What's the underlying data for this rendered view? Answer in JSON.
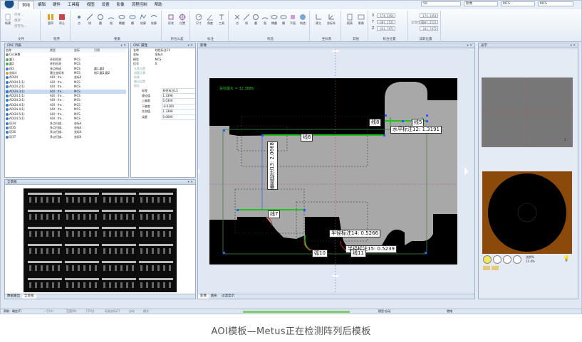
{
  "menu": {
    "items": [
      "常用",
      "编辑",
      "硬件",
      "工具箱",
      "视图",
      "设置",
      "影像",
      "流程控制",
      "帮助"
    ],
    "active": 0
  },
  "ribbon": {
    "groups": [
      {
        "label": "文件",
        "buttons": [
          "新建",
          "打开",
          "保存"
        ],
        "small": [
          "打开...",
          "保存",
          "另存为..."
        ]
      },
      {
        "label": "程序",
        "buttons": [
          "暂停",
          "停止"
        ]
      },
      {
        "label": "要素",
        "buttons": [
          "点",
          "线",
          "圆",
          "弧",
          "椭圆",
          "槽",
          "轮廓",
          "轮廓"
        ]
      },
      {
        "label": "形位公差",
        "buttons": [
          "形状",
          "位置"
        ]
      },
      {
        "label": "标注",
        "buttons": [
          "尺寸",
          "角度",
          "工具"
        ]
      },
      {
        "label": "构造",
        "buttons": [
          "点",
          "线",
          "圆",
          "弧",
          "椭圆",
          "槽",
          "平面",
          "构造"
        ]
      },
      {
        "label": "坐标系",
        "buttons": [
          "建立",
          "坐标系"
        ]
      },
      {
        "label": "其他",
        "buttons": [
          "报表",
          "影像"
        ]
      },
      {
        "label": "机台位置",
        "axes": [
          "X",
          "Y",
          "Z"
        ],
        "values": [
          "-174.3454",
          "-307.2521",
          "-341.7872"
        ],
        "button": "读取位置"
      },
      {
        "label": "读取位置",
        "values": [
          "-174.3454",
          "-307.2521",
          "-341.7872"
        ]
      }
    ],
    "combos": {
      "cam": "50",
      "mode": "影像",
      "coord": "MCS",
      "coord2": "MCS"
    }
  },
  "cnc_list": {
    "title": "CNC 列表",
    "headers": [
      "名称",
      "类型",
      "坐标",
      "引用"
    ],
    "rows": [
      {
        "name": "Cnc参数",
        "type": "",
        "coord": "",
        "ref": ""
      },
      {
        "name": "圆1",
        "type": "环形检测",
        "coord": "MCS",
        "ref": ""
      },
      {
        "name": "圆2",
        "type": "环形检测",
        "coord": "MCS",
        "ref": ""
      },
      {
        "name": "线3",
        "type": "多点构成",
        "coord": "MCS",
        "ref": "圆1,圆2"
      },
      {
        "name": "坐标4",
        "type": "建立坐标系",
        "coord": "MCS",
        "ref": "线3,圆1,圆2"
      },
      {
        "name": "AOI24",
        "type": "AOI : fre...",
        "coord": "坐标4",
        "ref": ""
      },
      {
        "name": "AOI24.1(1)",
        "type": "AOI : fre...",
        "coord": "MCS",
        "ref": ""
      },
      {
        "name": "AOI24.2(1)",
        "type": "AOI : fre...",
        "coord": "MCS",
        "ref": ""
      },
      {
        "name": "AOI24.3(1)",
        "type": "AOI : fre...",
        "coord": "MCS",
        "ref": ""
      },
      {
        "name": "AOI24.1(1)",
        "type": "AOI : fre...",
        "coord": "MCS",
        "ref": ""
      },
      {
        "name": "AOI24.3(1)",
        "type": "AOI : fre...",
        "coord": "MCS",
        "ref": ""
      },
      {
        "name": "AOI24.4(1)",
        "type": "AOI : fre...",
        "coord": "MCS",
        "ref": ""
      },
      {
        "name": "AOI24.4(1)",
        "type": "AOI : fre...",
        "coord": "MCS",
        "ref": ""
      },
      {
        "name": "AOI24.5(1)",
        "type": "AOI : fre...",
        "coord": "MCS",
        "ref": ""
      },
      {
        "name": "AOI24.5(1)",
        "type": "AOI : fre...",
        "coord": "MCS",
        "ref": ""
      },
      {
        "name": "项34",
        "type": "多点扫描...",
        "coord": "坐标4",
        "ref": ""
      },
      {
        "name": "项35",
        "type": "多点扫描...",
        "coord": "坐标4",
        "ref": ""
      },
      {
        "name": "项36",
        "type": "多点扫描...",
        "coord": "坐标4",
        "ref": ""
      },
      {
        "name": "项37",
        "type": "多点扫描...",
        "coord": "坐标4",
        "ref": ""
      }
    ],
    "selected": 8
  },
  "cnc_props": {
    "title": "CNC 属性",
    "basic": [
      {
        "k": "名称",
        "v": "线性标注13"
      },
      {
        "k": "坐标",
        "v": "坐标4"
      },
      {
        "k": "模型",
        "v": "MCS"
      },
      {
        "k": "信号",
        "v": "0"
      }
    ],
    "sections": [
      "元素设置",
      "测量元素",
      "结果",
      "输出设置",
      "报告"
    ],
    "measure": [
      {
        "k": "标签",
        "v": "线性标注13"
      },
      {
        "k": "理论值",
        "v": "1.3398"
      },
      {
        "k": "上偏差",
        "v": "0.0300"
      },
      {
        "k": "下偏差",
        "v": "-0.0300"
      },
      {
        "k": "实测值",
        "v": "1.3398"
      },
      {
        "k": "误差",
        "v": "0.0000"
      }
    ]
  },
  "overview": {
    "title": "全景图",
    "tabs": [
      "数据输出",
      "全景图"
    ]
  },
  "image_panel": {
    "title": "影像",
    "max_label": "关标最大 = 32.3686",
    "tabs": [
      "影像",
      "图形",
      "过滤显示"
    ],
    "annotations": {
      "line6": "线6",
      "line8": "线8",
      "line5": "线5",
      "horiz": "水平标注12: 1.3191",
      "vert": "垂直标注13: 2.0668",
      "line7": "线7",
      "r14": "半径标注14: 0.5266",
      "r15": "半径标注15: 0.5239",
      "arc10": "弧10",
      "line11": "线11"
    }
  },
  "light_panel": {
    "title": "光学",
    "count": "1",
    "label1": "比例%",
    "label2": "11.4%"
  },
  "status": {
    "left": "帮助：确定(F)",
    "items": [
      "一手(A)",
      "范围(M)",
      "[平均]",
      "标准坐标(F)",
      "自动",
      "模式"
    ],
    "right1": "模型:自动",
    "right2": "就绪"
  },
  "caption": "AOI模板—Metus正在检测阵列后模板"
}
